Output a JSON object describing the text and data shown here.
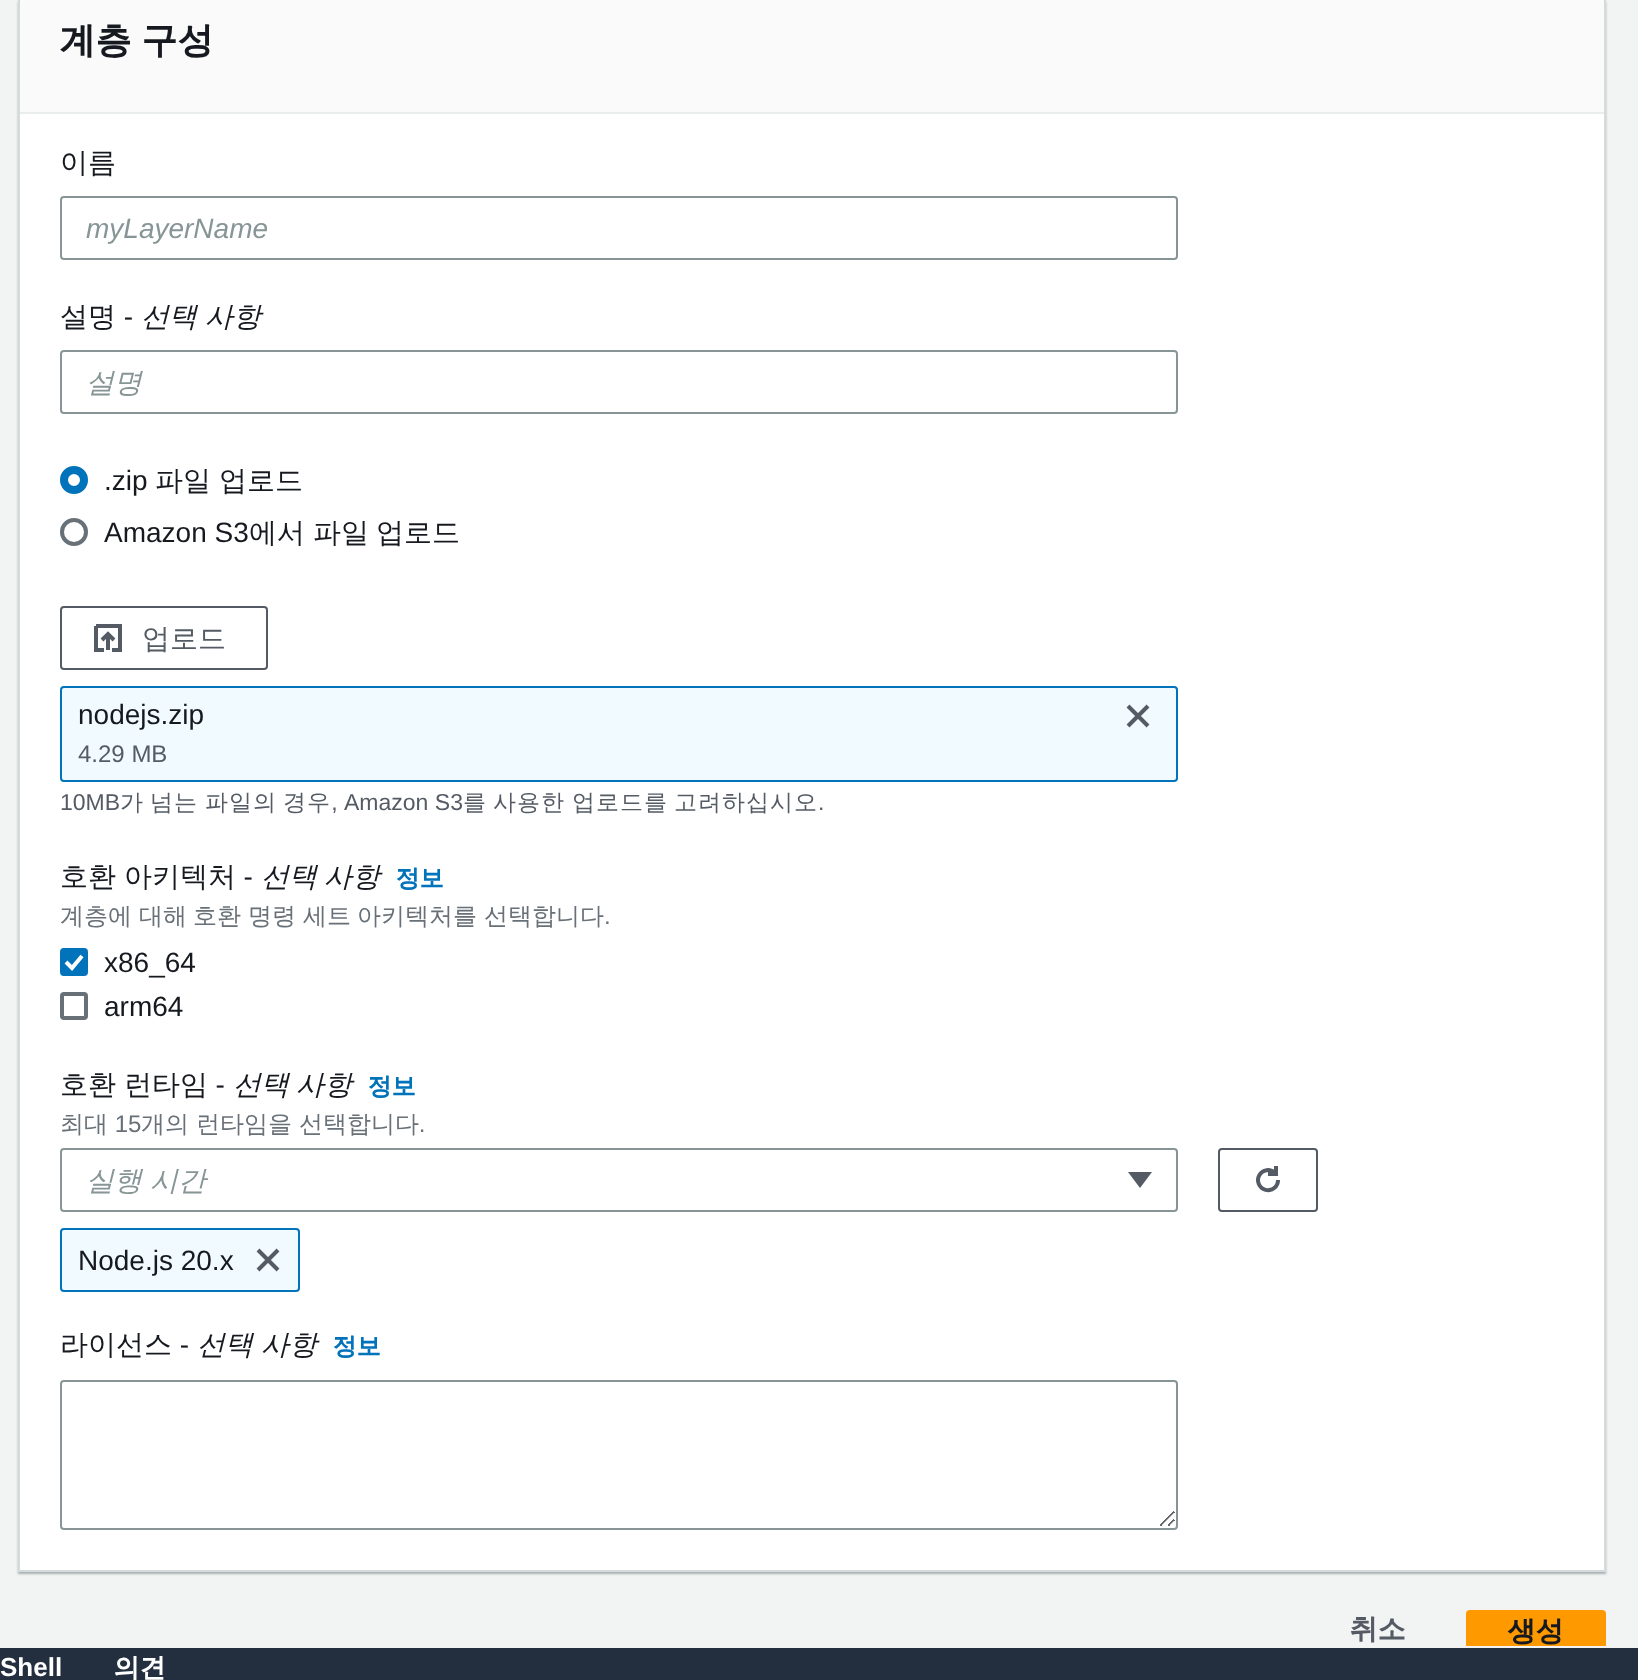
{
  "panel": {
    "title": "계층 구성"
  },
  "sections": [
    {
      "kind": "text",
      "label": "이름",
      "placeholder": "myLayerName"
    },
    {
      "kind": "text",
      "label": "설명 - *선택 사항*",
      "placeholder": "설명"
    },
    {
      "kind": "radio",
      "options": [
        {
          "label": ".zip 파일 업로드",
          "selected": true
        },
        {
          "label": "Amazon S3에서 파일 업로드",
          "selected": false
        }
      ]
    },
    {
      "kind": "upload",
      "button": "업로드",
      "file": {
        "name": "nodejs.zip",
        "size": "4.29 MB"
      },
      "hint": "10MB가 넘는 파일의 경우, Amazon S3를 사용한 업로드를 고려하십시오."
    },
    {
      "kind": "checkbox",
      "label": "호환 아키텍처 - *선택 사항*",
      "info": "정보",
      "description": "계층에 대해 호환 명령 세트 아키텍처를 선택합니다.",
      "options": [
        {
          "label": "x86_64",
          "checked": true
        },
        {
          "label": "arm64",
          "checked": false
        }
      ]
    },
    {
      "kind": "multiselect",
      "label": "호환 런타임 - *선택 사항*",
      "info": "정보",
      "description": "최대 15개의 런타임을 선택합니다.",
      "placeholder": "실행 시간",
      "tokens": [
        "Node.js 20.x"
      ]
    },
    {
      "kind": "textarea",
      "label": "라이선스 - *선택 사항*",
      "info": "정보"
    }
  ],
  "actions": [
    {
      "kind": "link",
      "label": "취소"
    },
    {
      "kind": "primary",
      "label": "생성"
    }
  ],
  "footer": [
    "Shell",
    "의견"
  ]
}
